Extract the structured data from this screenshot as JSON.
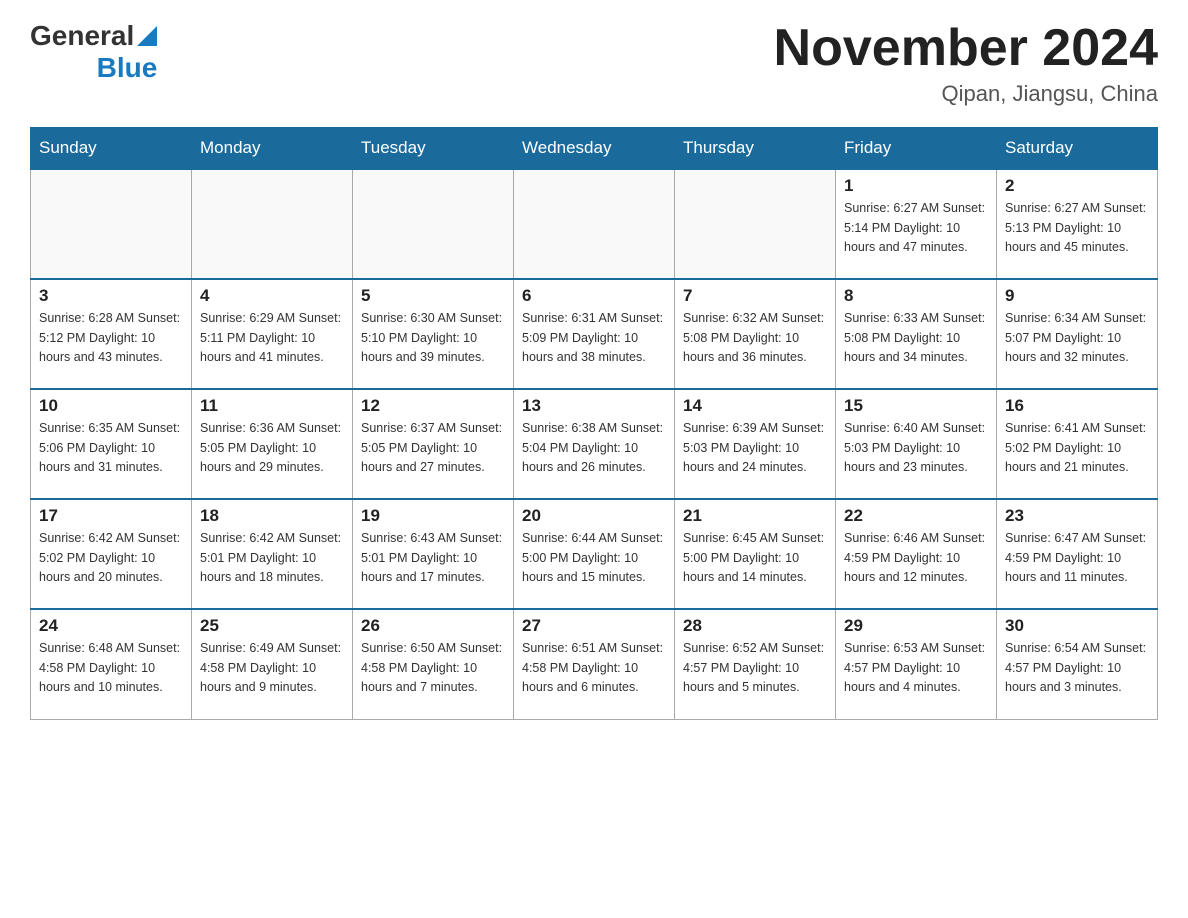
{
  "header": {
    "logo_general": "General",
    "logo_blue": "Blue",
    "month_title": "November 2024",
    "location": "Qipan, Jiangsu, China"
  },
  "days_of_week": [
    "Sunday",
    "Monday",
    "Tuesday",
    "Wednesday",
    "Thursday",
    "Friday",
    "Saturday"
  ],
  "weeks": [
    [
      {
        "day": "",
        "info": ""
      },
      {
        "day": "",
        "info": ""
      },
      {
        "day": "",
        "info": ""
      },
      {
        "day": "",
        "info": ""
      },
      {
        "day": "",
        "info": ""
      },
      {
        "day": "1",
        "info": "Sunrise: 6:27 AM\nSunset: 5:14 PM\nDaylight: 10 hours\nand 47 minutes."
      },
      {
        "day": "2",
        "info": "Sunrise: 6:27 AM\nSunset: 5:13 PM\nDaylight: 10 hours\nand 45 minutes."
      }
    ],
    [
      {
        "day": "3",
        "info": "Sunrise: 6:28 AM\nSunset: 5:12 PM\nDaylight: 10 hours\nand 43 minutes."
      },
      {
        "day": "4",
        "info": "Sunrise: 6:29 AM\nSunset: 5:11 PM\nDaylight: 10 hours\nand 41 minutes."
      },
      {
        "day": "5",
        "info": "Sunrise: 6:30 AM\nSunset: 5:10 PM\nDaylight: 10 hours\nand 39 minutes."
      },
      {
        "day": "6",
        "info": "Sunrise: 6:31 AM\nSunset: 5:09 PM\nDaylight: 10 hours\nand 38 minutes."
      },
      {
        "day": "7",
        "info": "Sunrise: 6:32 AM\nSunset: 5:08 PM\nDaylight: 10 hours\nand 36 minutes."
      },
      {
        "day": "8",
        "info": "Sunrise: 6:33 AM\nSunset: 5:08 PM\nDaylight: 10 hours\nand 34 minutes."
      },
      {
        "day": "9",
        "info": "Sunrise: 6:34 AM\nSunset: 5:07 PM\nDaylight: 10 hours\nand 32 minutes."
      }
    ],
    [
      {
        "day": "10",
        "info": "Sunrise: 6:35 AM\nSunset: 5:06 PM\nDaylight: 10 hours\nand 31 minutes."
      },
      {
        "day": "11",
        "info": "Sunrise: 6:36 AM\nSunset: 5:05 PM\nDaylight: 10 hours\nand 29 minutes."
      },
      {
        "day": "12",
        "info": "Sunrise: 6:37 AM\nSunset: 5:05 PM\nDaylight: 10 hours\nand 27 minutes."
      },
      {
        "day": "13",
        "info": "Sunrise: 6:38 AM\nSunset: 5:04 PM\nDaylight: 10 hours\nand 26 minutes."
      },
      {
        "day": "14",
        "info": "Sunrise: 6:39 AM\nSunset: 5:03 PM\nDaylight: 10 hours\nand 24 minutes."
      },
      {
        "day": "15",
        "info": "Sunrise: 6:40 AM\nSunset: 5:03 PM\nDaylight: 10 hours\nand 23 minutes."
      },
      {
        "day": "16",
        "info": "Sunrise: 6:41 AM\nSunset: 5:02 PM\nDaylight: 10 hours\nand 21 minutes."
      }
    ],
    [
      {
        "day": "17",
        "info": "Sunrise: 6:42 AM\nSunset: 5:02 PM\nDaylight: 10 hours\nand 20 minutes."
      },
      {
        "day": "18",
        "info": "Sunrise: 6:42 AM\nSunset: 5:01 PM\nDaylight: 10 hours\nand 18 minutes."
      },
      {
        "day": "19",
        "info": "Sunrise: 6:43 AM\nSunset: 5:01 PM\nDaylight: 10 hours\nand 17 minutes."
      },
      {
        "day": "20",
        "info": "Sunrise: 6:44 AM\nSunset: 5:00 PM\nDaylight: 10 hours\nand 15 minutes."
      },
      {
        "day": "21",
        "info": "Sunrise: 6:45 AM\nSunset: 5:00 PM\nDaylight: 10 hours\nand 14 minutes."
      },
      {
        "day": "22",
        "info": "Sunrise: 6:46 AM\nSunset: 4:59 PM\nDaylight: 10 hours\nand 12 minutes."
      },
      {
        "day": "23",
        "info": "Sunrise: 6:47 AM\nSunset: 4:59 PM\nDaylight: 10 hours\nand 11 minutes."
      }
    ],
    [
      {
        "day": "24",
        "info": "Sunrise: 6:48 AM\nSunset: 4:58 PM\nDaylight: 10 hours\nand 10 minutes."
      },
      {
        "day": "25",
        "info": "Sunrise: 6:49 AM\nSunset: 4:58 PM\nDaylight: 10 hours\nand 9 minutes."
      },
      {
        "day": "26",
        "info": "Sunrise: 6:50 AM\nSunset: 4:58 PM\nDaylight: 10 hours\nand 7 minutes."
      },
      {
        "day": "27",
        "info": "Sunrise: 6:51 AM\nSunset: 4:58 PM\nDaylight: 10 hours\nand 6 minutes."
      },
      {
        "day": "28",
        "info": "Sunrise: 6:52 AM\nSunset: 4:57 PM\nDaylight: 10 hours\nand 5 minutes."
      },
      {
        "day": "29",
        "info": "Sunrise: 6:53 AM\nSunset: 4:57 PM\nDaylight: 10 hours\nand 4 minutes."
      },
      {
        "day": "30",
        "info": "Sunrise: 6:54 AM\nSunset: 4:57 PM\nDaylight: 10 hours\nand 3 minutes."
      }
    ]
  ]
}
